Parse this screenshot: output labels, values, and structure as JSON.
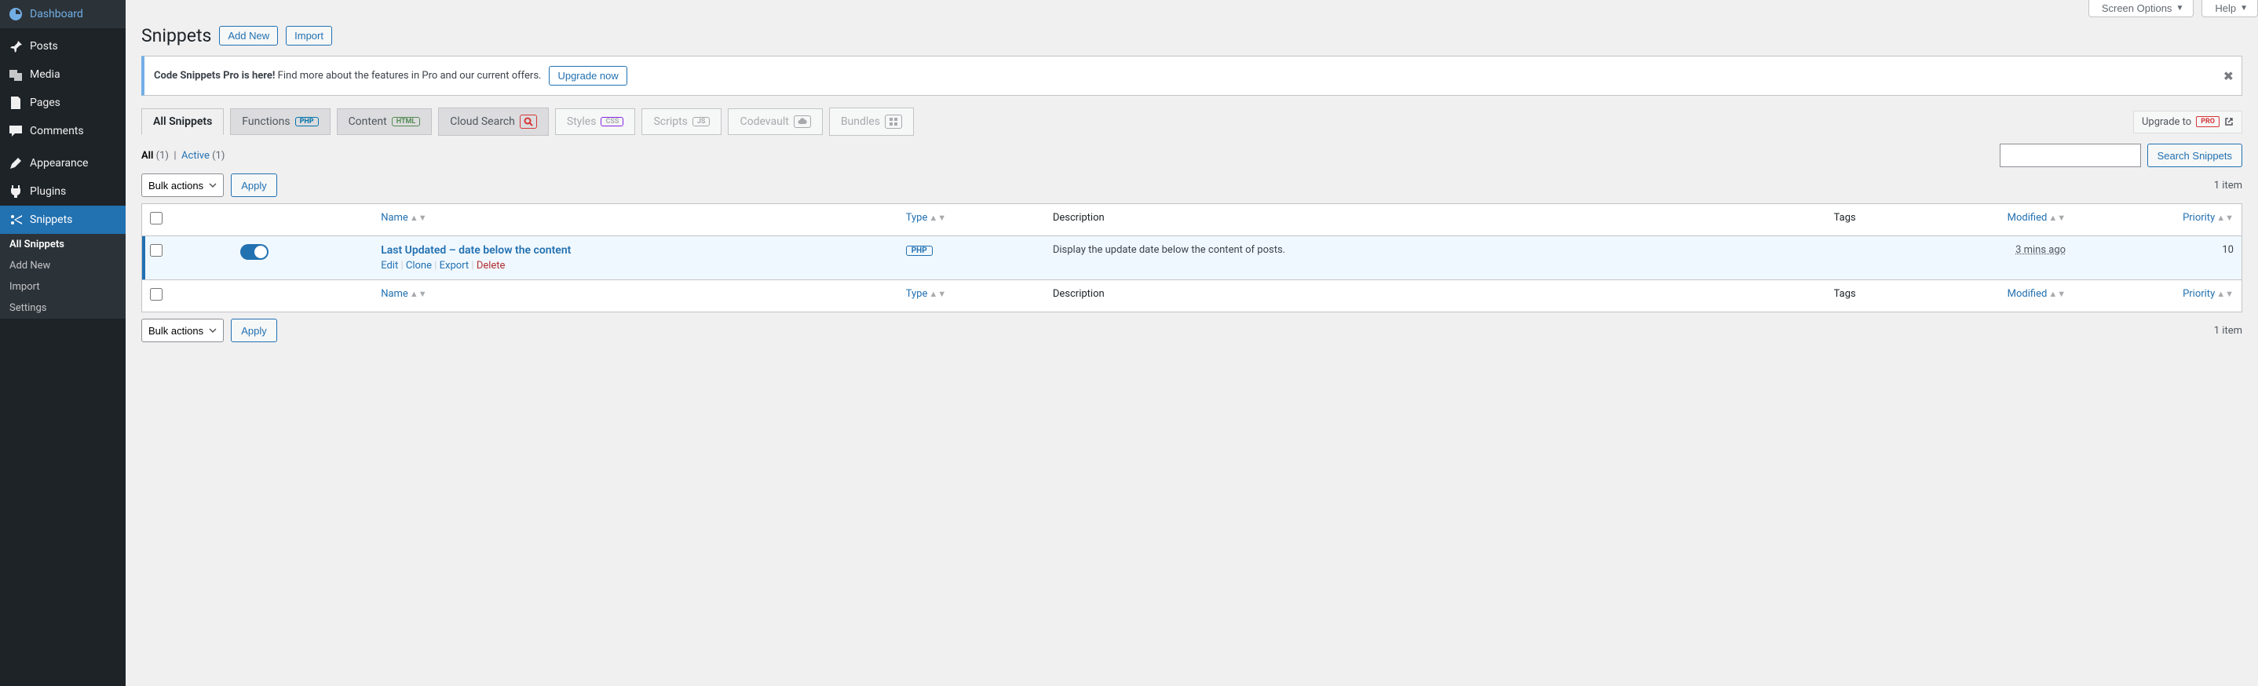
{
  "screen_meta": {
    "screen_options": "Screen Options",
    "help": "Help"
  },
  "sidebar": {
    "items": [
      {
        "label": "Dashboard",
        "icon": "dashboard"
      },
      {
        "label": "Posts",
        "icon": "pin"
      },
      {
        "label": "Media",
        "icon": "media"
      },
      {
        "label": "Pages",
        "icon": "pages"
      },
      {
        "label": "Comments",
        "icon": "comments"
      },
      {
        "label": "Appearance",
        "icon": "appearance"
      },
      {
        "label": "Plugins",
        "icon": "plugins"
      },
      {
        "label": "Snippets",
        "icon": "snippets"
      }
    ],
    "sub": [
      {
        "label": "All Snippets",
        "current": true
      },
      {
        "label": "Add New"
      },
      {
        "label": "Import"
      },
      {
        "label": "Settings"
      }
    ]
  },
  "page": {
    "title": "Snippets",
    "add_new": "Add New",
    "import": "Import"
  },
  "notice": {
    "strong": "Code Snippets Pro is here!",
    "text": " Find more about the features in Pro and our current offers. ",
    "cta": "Upgrade now"
  },
  "tabs": {
    "all": "All Snippets",
    "functions": "Functions",
    "content": "Content",
    "cloud": "Cloud Search",
    "styles": "Styles",
    "scripts": "Scripts",
    "codevault": "Codevault",
    "bundles": "Bundles",
    "php": "PHP",
    "html": "HTML",
    "css": "CSS",
    "js": "JS",
    "upgrade": "Upgrade to",
    "pro": "PRO"
  },
  "subsub": {
    "all_label": "All",
    "all_count": "(1)",
    "active_label": "Active",
    "active_count": "(1)",
    "search_btn": "Search Snippets"
  },
  "bulk": {
    "label": "Bulk actions",
    "apply": "Apply"
  },
  "count": "1 item",
  "columns": {
    "name": "Name",
    "type": "Type",
    "description": "Description",
    "tags": "Tags",
    "modified": "Modified",
    "priority": "Priority"
  },
  "row": {
    "title": "Last Updated – date below the content",
    "type_badge": "PHP",
    "description": "Display the update date below the content of posts.",
    "modified": "3 mins ago",
    "priority": "10",
    "actions": {
      "edit": "Edit",
      "clone": "Clone",
      "export": "Export",
      "delete": "Delete"
    }
  }
}
